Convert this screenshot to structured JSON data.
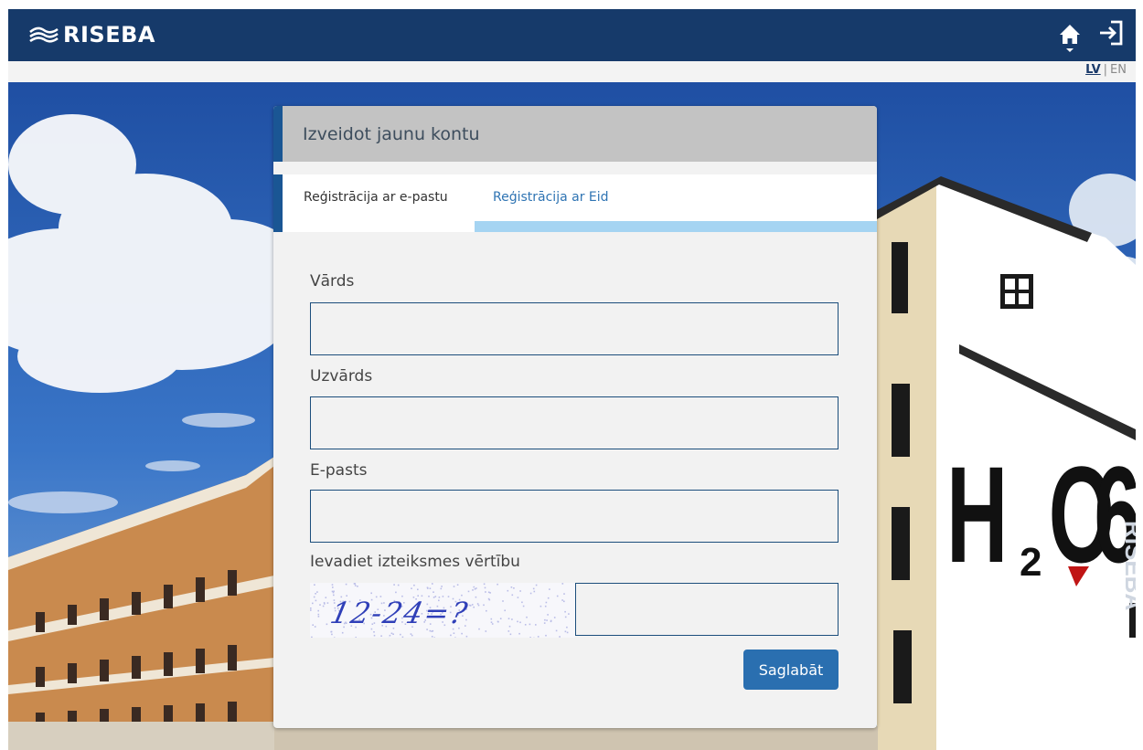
{
  "header": {
    "logo_text": "RISEBA",
    "logo_icon": "riseba-wave-logo",
    "home_icon": "home-icon",
    "login_icon": "sign-in-icon",
    "background_color": "#163a6a"
  },
  "language": {
    "lv": "LV",
    "separator": "|",
    "en": "EN",
    "selected": "LV"
  },
  "background": {
    "building_text": "H2O 6",
    "side_text": "RISEBA"
  },
  "form": {
    "title": "Izveidot jaunu kontu",
    "tabs": [
      {
        "label": "Reģistrācija ar e-pastu",
        "active": true
      },
      {
        "label": "Reģistrācija ar Eid",
        "active": false
      }
    ],
    "fields": {
      "first_name": {
        "label": "Vārds",
        "value": ""
      },
      "last_name": {
        "label": "Uzvārds",
        "value": ""
      },
      "email": {
        "label": "E-pasts",
        "value": ""
      },
      "captcha": {
        "label": "Ievadiet izteiksmes vērtību",
        "image_text": "12-24=?",
        "value": ""
      }
    },
    "save_label": "Saglabāt"
  },
  "colors": {
    "accent": "#1a5694",
    "tab_underline": "#a5d4f2",
    "button": "#2a6fb0",
    "card_header": "#c3c3c3"
  }
}
